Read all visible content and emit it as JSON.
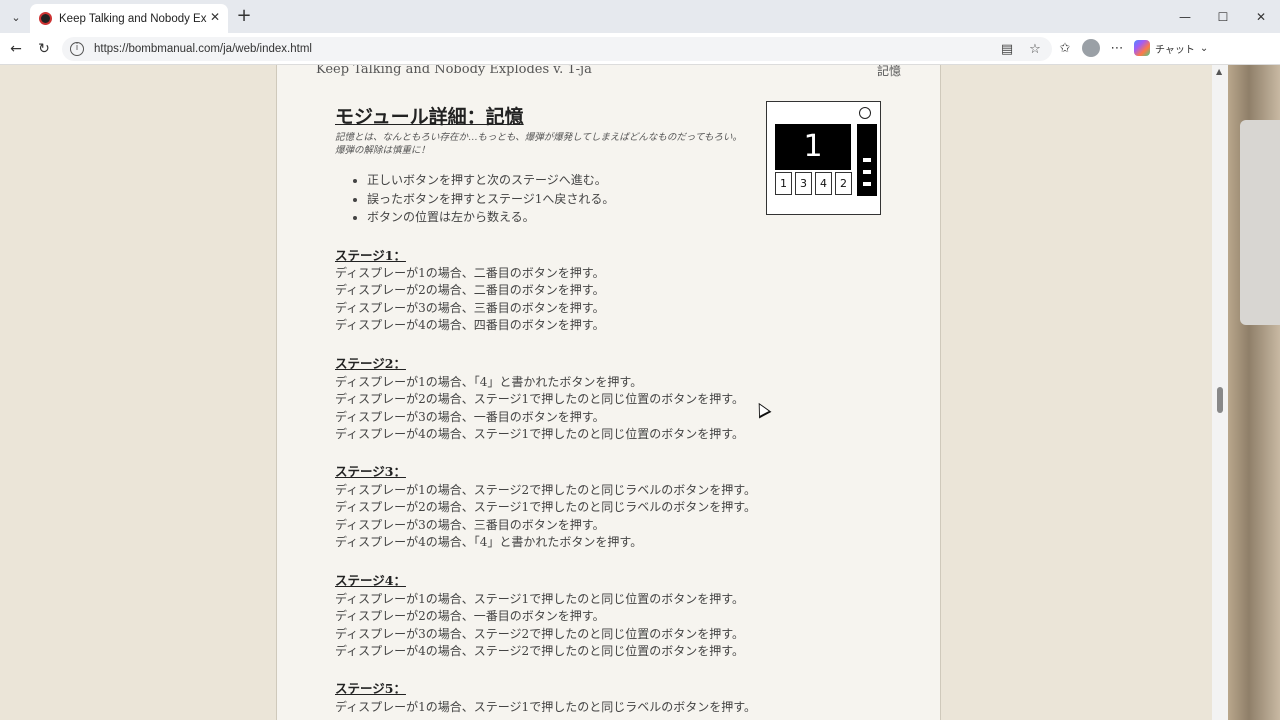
{
  "browser": {
    "tab_title": "Keep Talking and Nobody Explodes",
    "url": "https://bombmanual.com/ja/web/index.html",
    "copilot_label": "チャット"
  },
  "page": {
    "header_title": "Keep Talking and Nobody Explodes v. 1-ja",
    "header_section": "記憶",
    "module_title": "モジュール詳細：記憶",
    "flavor_text": "記憶とは、なんともろい存在か…もっとも、爆弾が爆発してしまえばどんなものだってもろい。爆弾の解除は慎重に！",
    "bullets": [
      "正しいボタンを押すと次のステージへ進む。",
      "誤ったボタンを押すとステージ1へ戻される。",
      "ボタンの位置は左から数える。"
    ],
    "module": {
      "display_value": "1",
      "buttons": [
        "1",
        "3",
        "4",
        "2"
      ]
    },
    "stages": [
      {
        "title": "ステージ1：",
        "rules": [
          "ディスプレーが1の場合、二番目のボタンを押す。",
          "ディスプレーが2の場合、二番目のボタンを押す。",
          "ディスプレーが3の場合、三番目のボタンを押す。",
          "ディスプレーが4の場合、四番目のボタンを押す。"
        ]
      },
      {
        "title": "ステージ2：",
        "rules": [
          "ディスプレーが1の場合、「4」と書かれたボタンを押す。",
          "ディスプレーが2の場合、ステージ1で押したのと同じ位置のボタンを押す。",
          "ディスプレーが3の場合、一番目のボタンを押す。",
          "ディスプレーが4の場合、ステージ1で押したのと同じ位置のボタンを押す。"
        ]
      },
      {
        "title": "ステージ3：",
        "rules": [
          "ディスプレーが1の場合、ステージ2で押したのと同じラベルのボタンを押す。",
          "ディスプレーが2の場合、ステージ1で押したのと同じラベルのボタンを押す。",
          "ディスプレーが3の場合、三番目のボタンを押す。",
          "ディスプレーが4の場合、「4」と書かれたボタンを押す。"
        ]
      },
      {
        "title": "ステージ4：",
        "rules": [
          "ディスプレーが1の場合、ステージ1で押したのと同じ位置のボタンを押す。",
          "ディスプレーが2の場合、一番目のボタンを押す。",
          "ディスプレーが3の場合、ステージ2で押したのと同じ位置のボタンを押す。",
          "ディスプレーが4の場合、ステージ2で押したのと同じ位置のボタンを押す。"
        ]
      },
      {
        "title": "ステージ5：",
        "rules": [
          "ディスプレーが1の場合、ステージ1で押したのと同じラベルのボタンを押す。"
        ]
      }
    ]
  },
  "icons": {
    "tab_list": "chevron-down-icon",
    "close": "close-icon",
    "new_tab": "plus-icon",
    "back": "arrow-left-icon",
    "reload": "reload-icon",
    "site_info": "info-icon",
    "reader": "reader-icon",
    "favorite": "star-icon",
    "collections": "collections-icon",
    "more": "more-icon"
  }
}
